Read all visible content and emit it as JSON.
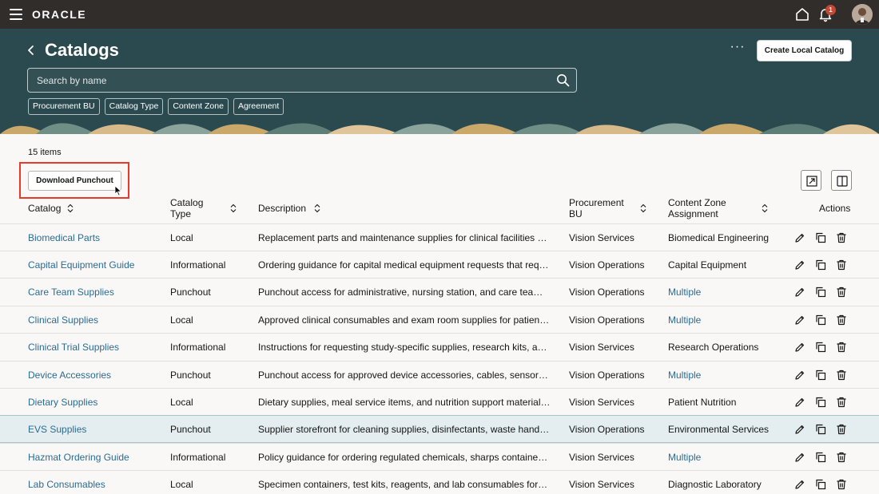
{
  "app": {
    "brand": "ORACLE",
    "notification_count": "1"
  },
  "header": {
    "title": "Catalogs",
    "more_label": "···",
    "create_button": "Create Local Catalog",
    "search_placeholder": "Search by name",
    "filters": [
      "Procurement BU",
      "Catalog Type",
      "Content Zone",
      "Agreement"
    ]
  },
  "list": {
    "count_label": "15 items",
    "download_button": "Download Punchout",
    "columns": {
      "catalog": "Catalog",
      "type_line1": "Catalog",
      "type_line2": "Type",
      "description": "Description",
      "bu_line1": "Procurement",
      "bu_line2": "BU",
      "zone_line1": "Content Zone",
      "zone_line2": "Assignment",
      "actions": "Actions"
    },
    "rows": [
      {
        "catalog": "Biomedical Parts",
        "type": "Local",
        "description": "Replacement parts and maintenance supplies for clinical facilities an…",
        "bu": "Vision Services",
        "zone": "Biomedical Engineering",
        "zone_link": false
      },
      {
        "catalog": "Capital Equipment Guide",
        "type": "Informational",
        "description": "Ordering guidance for capital medical equipment requests that requi…",
        "bu": "Vision Operations",
        "zone": "Capital Equipment",
        "zone_link": false
      },
      {
        "catalog": "Care Team Supplies",
        "type": "Punchout",
        "description": "Punchout access for administrative, nursing station, and care team…",
        "bu": "Vision Operations",
        "zone": "Multiple",
        "zone_link": true
      },
      {
        "catalog": "Clinical Supplies",
        "type": "Local",
        "description": "Approved clinical consumables and exam room supplies for patient…",
        "bu": "Vision Operations",
        "zone": "Multiple",
        "zone_link": true
      },
      {
        "catalog": "Clinical Trial Supplies",
        "type": "Informational",
        "description": "Instructions for requesting study-specific supplies, research kits, and…",
        "bu": "Vision Services",
        "zone": "Research Operations",
        "zone_link": false
      },
      {
        "catalog": "Device Accessories",
        "type": "Punchout",
        "description": "Punchout access for approved device accessories, cables, sensors, a…",
        "bu": "Vision Operations",
        "zone": "Multiple",
        "zone_link": true
      },
      {
        "catalog": "Dietary Supplies",
        "type": "Local",
        "description": "Dietary supplies, meal service items, and nutrition support materials…",
        "bu": "Vision Services",
        "zone": "Patient Nutrition",
        "zone_link": false
      },
      {
        "catalog": "EVS Supplies",
        "type": "Punchout",
        "description": "Supplier storefront for cleaning supplies, disinfectants, waste handli…",
        "bu": "Vision Operations",
        "zone": "Environmental Services",
        "zone_link": false,
        "selected": true
      },
      {
        "catalog": "Hazmat Ordering Guide",
        "type": "Informational",
        "description": "Policy guidance for ordering regulated chemicals, sharps containers,…",
        "bu": "Vision Services",
        "zone": "Multiple",
        "zone_link": true
      },
      {
        "catalog": "Lab Consumables",
        "type": "Local",
        "description": "Specimen containers, test kits, reagents, and lab consumables for…",
        "bu": "Vision Services",
        "zone": "Diagnostic Laboratory",
        "zone_link": false
      }
    ]
  },
  "colors": {
    "topbar": "#312d2a",
    "header": "#2b4a4f",
    "link": "#2a6b94",
    "highlight": "#e8392a",
    "selected_row": "#e4eef1"
  },
  "icons": [
    "hamburger-icon",
    "home-icon",
    "bell-icon",
    "back-icon",
    "search-icon",
    "export-icon",
    "columns-icon",
    "sort-icon",
    "edit-icon",
    "duplicate-icon",
    "delete-icon"
  ]
}
